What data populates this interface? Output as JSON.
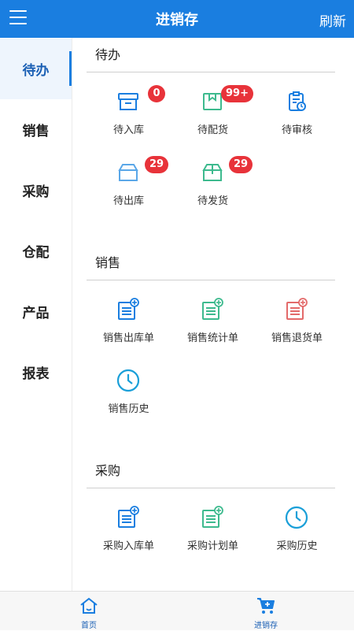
{
  "header": {
    "title": "进销存",
    "refresh_label": "刷新",
    "menu_icon": "hamburger-icon",
    "color": "#1a7ee0"
  },
  "sidebar": {
    "items": [
      {
        "label": "待办",
        "active": true
      },
      {
        "label": "销售"
      },
      {
        "label": "采购"
      },
      {
        "label": "仓配"
      },
      {
        "label": "产品"
      },
      {
        "label": "报表"
      }
    ]
  },
  "sections": {
    "todo": {
      "title": "待办",
      "items": [
        {
          "label": "待入库",
          "badge": "0",
          "icon": "inbox-box-icon"
        },
        {
          "label": "待配货",
          "badge": "99+",
          "icon": "package-icon"
        },
        {
          "label": "待审核",
          "badge": "",
          "icon": "clipboard-clock-icon"
        },
        {
          "label": "待出库",
          "badge": "29",
          "icon": "box-icon"
        },
        {
          "label": "待发货",
          "badge": "29",
          "icon": "shipping-box-icon"
        }
      ]
    },
    "sales": {
      "title": "销售",
      "items": [
        {
          "label": "销售出库单",
          "icon": "form-add-icon"
        },
        {
          "label": "销售统计单",
          "icon": "form-add-icon"
        },
        {
          "label": "销售退货单",
          "icon": "form-add-icon"
        },
        {
          "label": "销售历史",
          "icon": "clock-icon"
        }
      ]
    },
    "purchase": {
      "title": "采购",
      "items": [
        {
          "label": "采购入库单",
          "icon": "form-add-icon"
        },
        {
          "label": "采购计划单",
          "icon": "form-add-icon"
        },
        {
          "label": "采购历史",
          "icon": "clock-icon"
        }
      ]
    }
  },
  "bottom_nav": {
    "home_label": "首页",
    "home_icon": "home-icon",
    "inventory_label": "进销存",
    "inventory_icon": "cart-icon"
  },
  "colors": {
    "badge": "#e8333a",
    "blue_icon": "#1a7ee0",
    "green_icon": "#3dba8e",
    "red_icon": "#e36a6a"
  }
}
